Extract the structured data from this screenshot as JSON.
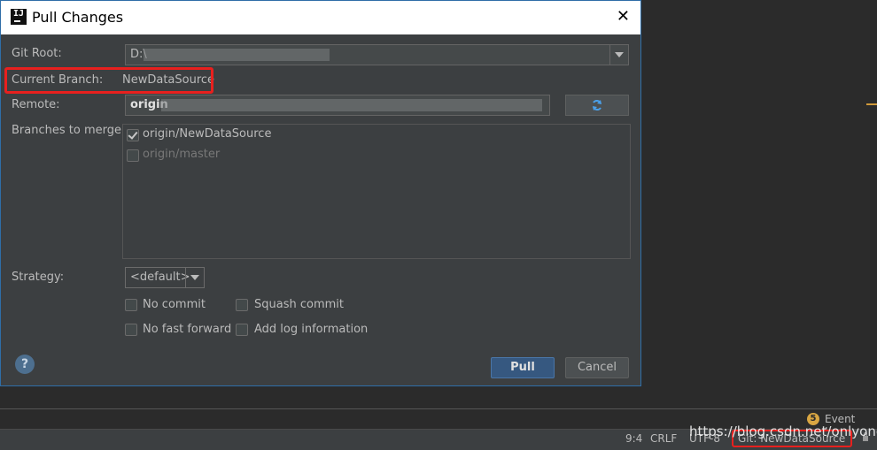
{
  "dialog": {
    "title": "Pull Changes",
    "git_root": {
      "label": "Git Root:",
      "value": "D:\\"
    },
    "current_branch": {
      "label": "Current Branch:",
      "value": "NewDataSource"
    },
    "remote": {
      "label": "Remote:",
      "value": "origin"
    },
    "branches": {
      "label": "Branches to merge:",
      "items": [
        {
          "label": "origin/NewDataSource",
          "checked": true
        },
        {
          "label": "origin/master",
          "checked": false
        }
      ]
    },
    "strategy": {
      "label": "Strategy:",
      "value": "<default>"
    },
    "options": {
      "no_commit": "No commit",
      "squash_commit": "Squash commit",
      "no_fast_forward": "No fast forward",
      "add_log": "Add log information"
    },
    "buttons": {
      "pull": "Pull",
      "cancel": "Cancel"
    },
    "help_glyph": "?"
  },
  "event_log": {
    "count": "5",
    "label": "Event Log"
  },
  "watermark": "https://blog.csdn.net/onlyone",
  "statusbar": {
    "position": "9:4",
    "line_endings": "CRLF",
    "encoding": "UTF-8",
    "git_branch": "Git: NewDataSource"
  },
  "colors": {
    "accent": "#365880",
    "highlight": "#e8201e"
  }
}
